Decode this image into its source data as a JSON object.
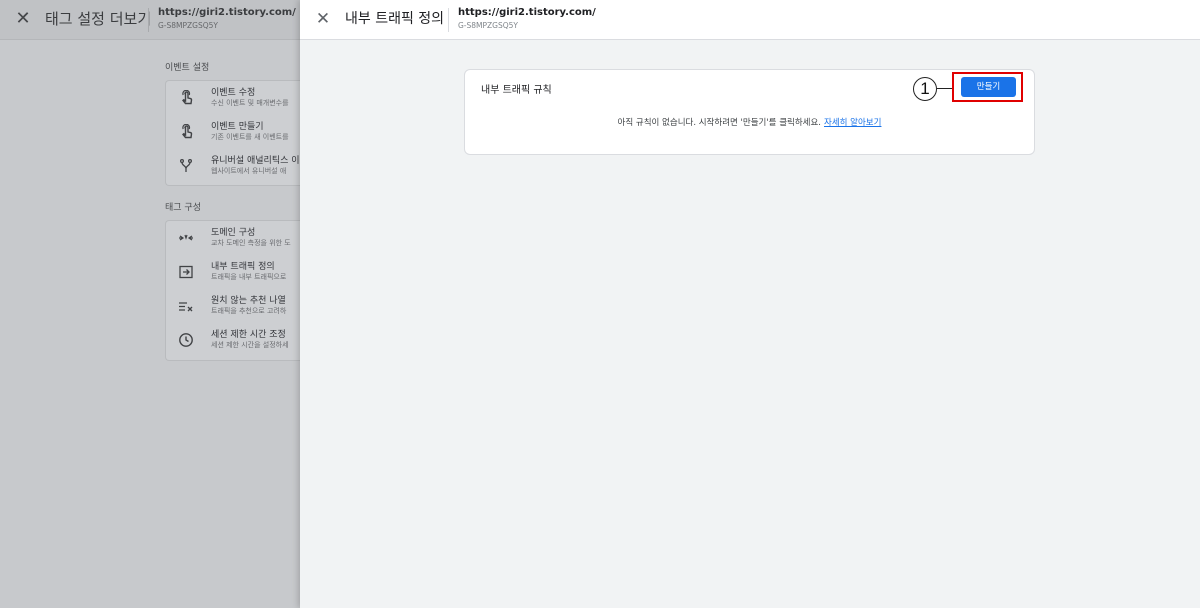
{
  "background_panel": {
    "title": "태그 설정 더보기",
    "url": "https://giri2.tistory.com/",
    "measurement_id": "G-S8MPZGSQ5Y",
    "sections": [
      {
        "label": "이벤트 설정",
        "items": [
          {
            "icon": "touch-icon",
            "title": "이벤트 수정",
            "subtitle": "수신 이벤트 및 매개변수를"
          },
          {
            "icon": "touch-icon",
            "title": "이벤트 만들기",
            "subtitle": "기존 이벤트를 새 이벤트를"
          },
          {
            "icon": "fork-icon",
            "title": "유니버설 애널리틱스 이",
            "subtitle": "웹사이트에서 유니버설 애"
          }
        ]
      },
      {
        "label": "태그 구성",
        "items": [
          {
            "icon": "merge-icon",
            "title": "도메인 구성",
            "subtitle": "교차 도메인 측정을 위한 도"
          },
          {
            "icon": "input-icon",
            "title": "내부 트래픽 정의",
            "subtitle": "트래픽을 내부 트래픽으로"
          },
          {
            "icon": "filter-list-icon",
            "title": "원치 않는 추천 나열",
            "subtitle": "트래픽을 추천으로 고려하"
          },
          {
            "icon": "clock-icon",
            "title": "세션 제한 시간 조정",
            "subtitle": "세션 제한 시간을 설정하세"
          }
        ]
      }
    ]
  },
  "drawer": {
    "title": "내부 트래픽 정의",
    "url": "https://giri2.tistory.com/",
    "measurement_id": "G-S8MPZGSQ5Y",
    "close_icon": "close-icon",
    "rules_card": {
      "title": "내부 트래픽 규칙",
      "empty_message": "아직 규칙이 없습니다. 시작하려면 '만들기'를 클릭하세요.",
      "learn_more": "자세히 알아보기",
      "create_button": "만들기"
    },
    "annotation": {
      "number": "1",
      "color": "#e00000"
    }
  },
  "colors": {
    "primary": "#1a73e8",
    "overlay": "#c7c9cc",
    "drawer_bg": "#f1f3f4"
  }
}
